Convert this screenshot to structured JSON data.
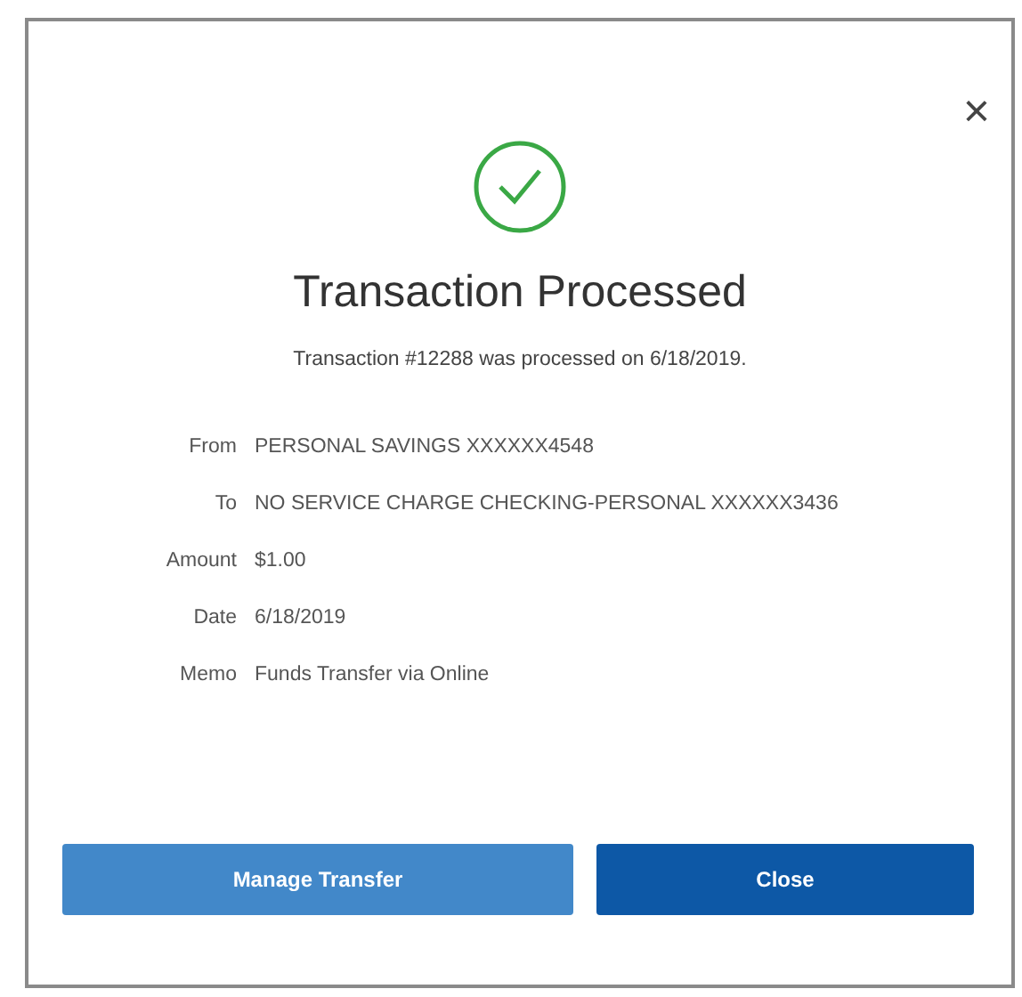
{
  "dialog": {
    "close_icon": "×",
    "title": "Transaction Processed",
    "message": "Transaction #12288 was processed on 6/18/2019.",
    "details": [
      {
        "label": "From",
        "value": "PERSONAL SAVINGS XXXXXX4548"
      },
      {
        "label": "To",
        "value": "NO SERVICE CHARGE CHECKING-PERSONAL XXXXXX3436"
      },
      {
        "label": "Amount",
        "value": "$1.00"
      },
      {
        "label": "Date",
        "value": "6/18/2019"
      },
      {
        "label": "Memo",
        "value": "Funds Transfer via Online"
      }
    ],
    "buttons": [
      {
        "label": "Manage Transfer",
        "kind": "secondary"
      },
      {
        "label": "Close",
        "kind": "primary"
      }
    ]
  }
}
